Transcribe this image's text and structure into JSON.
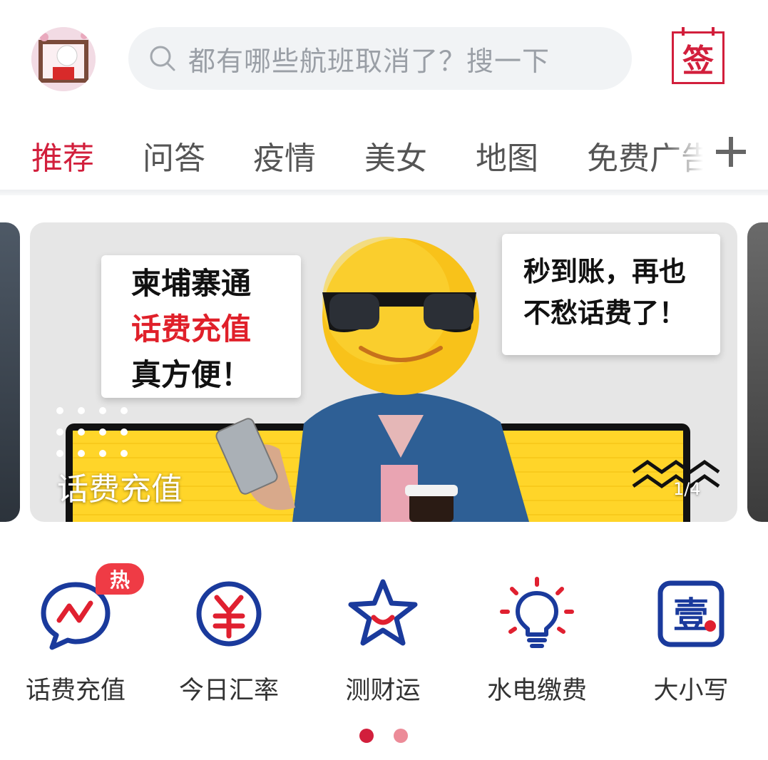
{
  "header": {
    "search_placeholder": "都有哪些航班取消了？搜一下",
    "sign_label": "签"
  },
  "tabs": [
    {
      "label": "推荐",
      "active": true
    },
    {
      "label": "问答"
    },
    {
      "label": "疫情"
    },
    {
      "label": "美女"
    },
    {
      "label": "地图"
    },
    {
      "label": "免费广告"
    }
  ],
  "banner": {
    "bubble_left": {
      "line1": "柬埔寨通",
      "line2": "话费充值",
      "line3": "真方便！"
    },
    "bubble_right": {
      "line1": "秒到账，再也",
      "line2": "不愁话费了！"
    },
    "title": "话费充值",
    "page_indicator": "1/4"
  },
  "quick_actions": [
    {
      "label": "话费充值",
      "icon": "chat-bubble-chart-icon",
      "badge": "热"
    },
    {
      "label": "今日汇率",
      "icon": "yuan-circle-icon"
    },
    {
      "label": "测财运",
      "icon": "smiling-star-icon"
    },
    {
      "label": "水电缴费",
      "icon": "lightbulb-icon"
    },
    {
      "label": "大小写",
      "icon": "numeral-yi-icon",
      "icon_text": "壹"
    }
  ],
  "colors": {
    "accent_red": "#d21f3c",
    "icon_blue": "#1a3a9c",
    "badge_red": "#ef3b45"
  },
  "pager": {
    "pages": 2,
    "active_page": 1
  }
}
